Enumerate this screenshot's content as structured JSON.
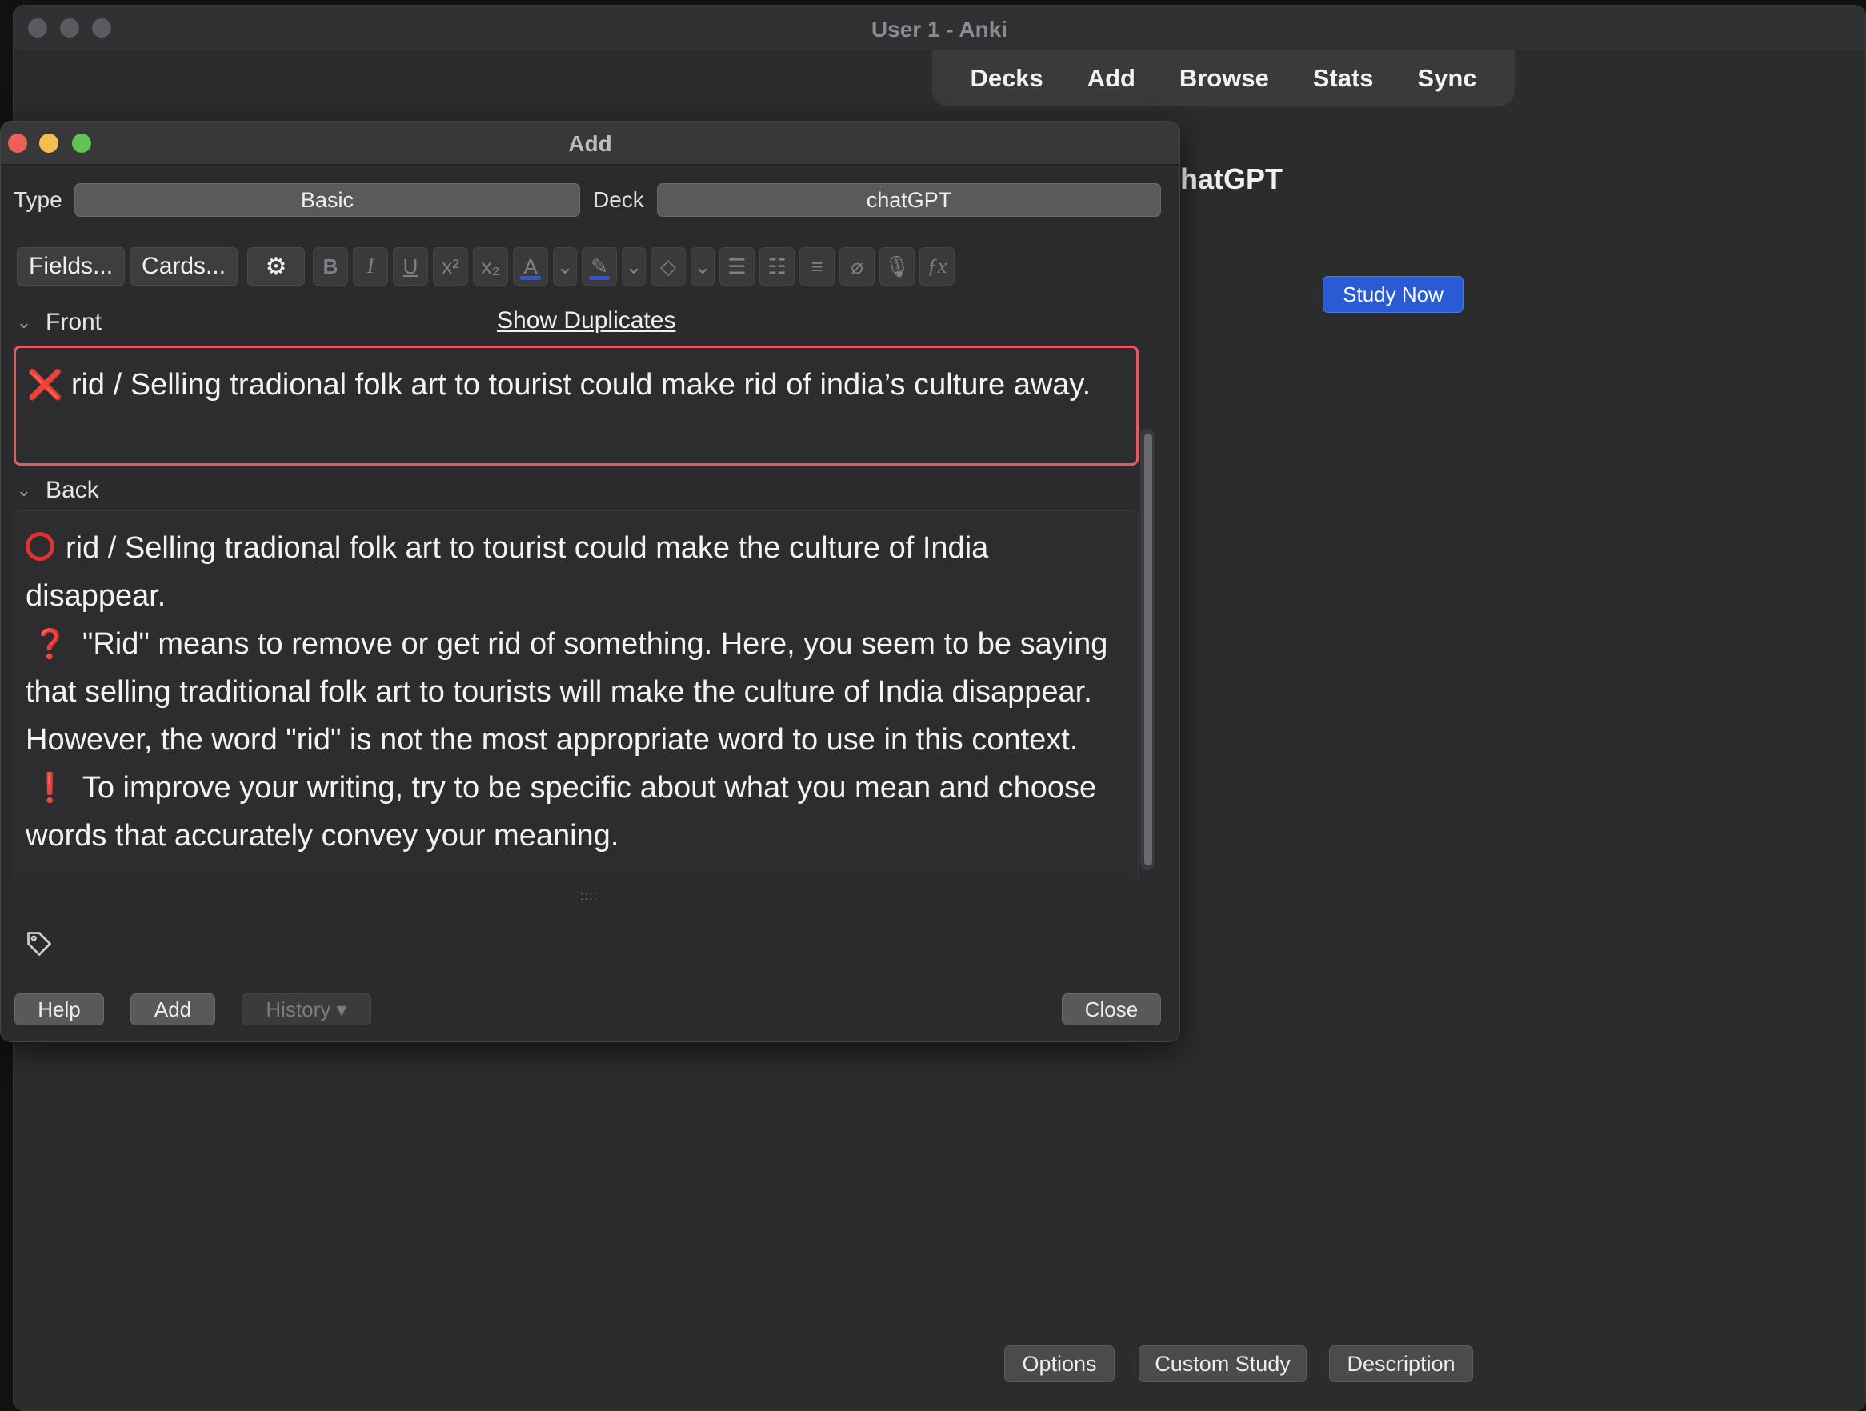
{
  "main_window": {
    "title": "User 1 - Anki",
    "toolbar": [
      "Decks",
      "Add",
      "Browse",
      "Stats",
      "Sync"
    ],
    "deck_title_partial": "hatGPT",
    "study_now": "Study Now",
    "bottom_buttons": [
      "Options",
      "Custom Study",
      "Description"
    ]
  },
  "add_dialog": {
    "title": "Add",
    "type_label": "Type",
    "type_value": "Basic",
    "deck_label": "Deck",
    "deck_value": "chatGPT",
    "fields_button": "Fields...",
    "cards_button": "Cards...",
    "format_buttons": [
      {
        "name": "gear-icon",
        "glyph": "⚙"
      },
      {
        "name": "bold-icon",
        "glyph": "B"
      },
      {
        "name": "italic-icon",
        "glyph": "I"
      },
      {
        "name": "underline-icon",
        "glyph": "U"
      },
      {
        "name": "superscript-icon",
        "glyph": "x²"
      },
      {
        "name": "subscript-icon",
        "glyph": "x₂"
      }
    ],
    "front": {
      "label": "Front",
      "show_duplicates": "Show Duplicates",
      "mark": "❌",
      "text": "rid / Selling tradional folk art to tourist could make rid of india’s culture away."
    },
    "back": {
      "label": "Back",
      "line1_text": "rid / Selling tradional folk art to tourist could make the culture of India disappear.",
      "q_mark": "❓",
      "line2_text": "\"Rid\" means to remove or get rid of something. Here, you seem to be saying that selling traditional folk art to tourists will make the culture of India disappear. However, the word \"rid\" is not the most appropriate word to use in this context.",
      "ex_mark": "❗",
      "line3_text": "To improve your writing, try to be specific about what you mean and choose words that accurately convey your meaning."
    },
    "splitter_glyph": "::::",
    "buttons": {
      "help": "Help",
      "add": "Add",
      "history": "History ▾",
      "close": "Close"
    }
  },
  "colors": {
    "accent_blue": "#2a5ad4",
    "error_red": "#e85a5a",
    "traffic_red": "#ee5f57",
    "traffic_yellow": "#f4bd4f",
    "traffic_green": "#5fc454"
  }
}
